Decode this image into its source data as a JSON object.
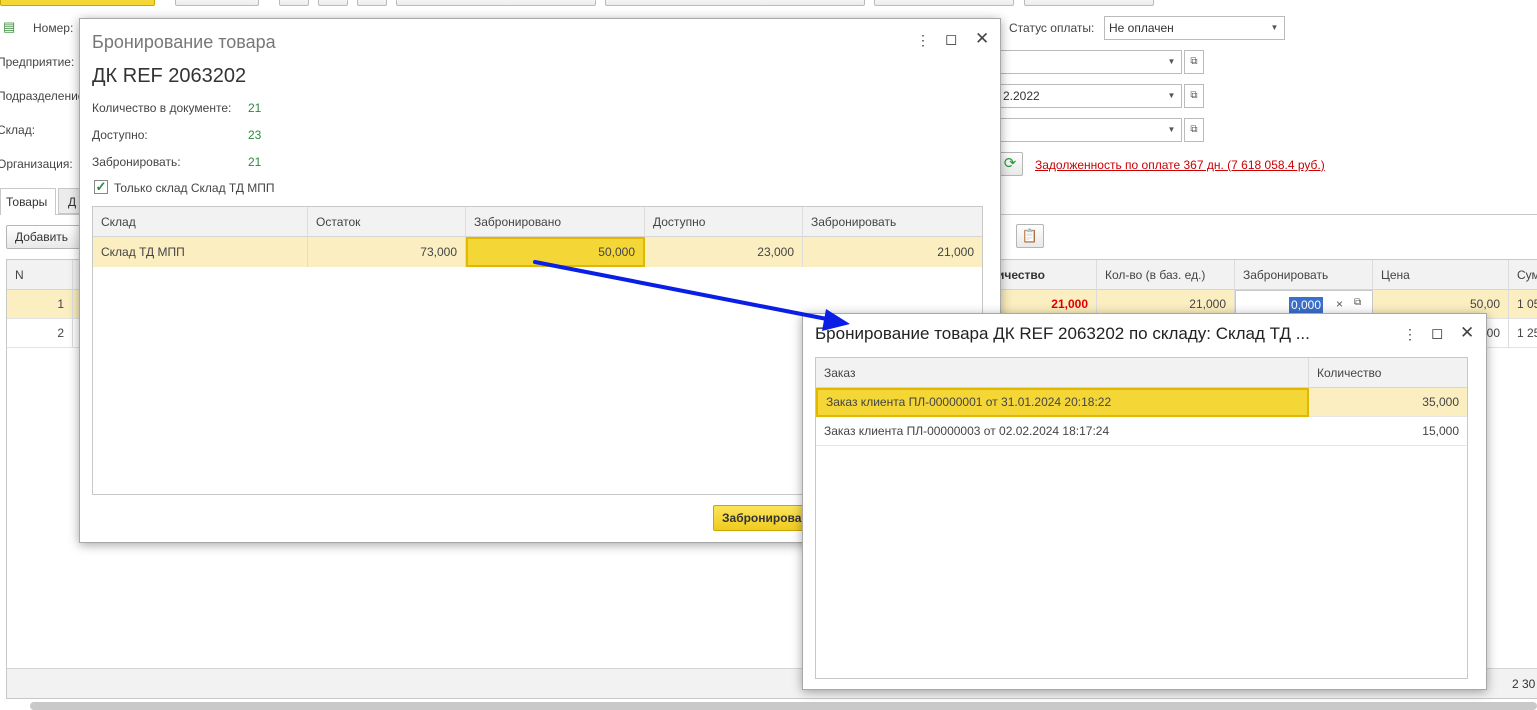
{
  "form": {
    "nomer_label": "Номер:",
    "predpriyatie_label": "Предприятие:",
    "podrazdelenie_label": "Подразделение:",
    "sklad_label": "Склад:",
    "organizaciya_label": "Организация:",
    "status_label": "Статус оплаты:",
    "status_value": "Не оплачен",
    "date_partial": "2.2022",
    "debt_link": "Задолженность по оплате 367 дн. (7 618 058.4 руб.)"
  },
  "tabs": {
    "goods": "Товары",
    "second_partial": "Д"
  },
  "toolbar": {
    "add_label": "Добавить"
  },
  "main_table": {
    "headers": {
      "n": "N",
      "qty_partial": "ичество",
      "qty_base": "Кол-во (в баз. ед.)",
      "reserve": "Забронировать",
      "price": "Цена",
      "sum_partial": "Сум"
    },
    "rows": [
      {
        "n": "1",
        "qty": "21,000",
        "qty_base": "21,000",
        "reserve": "0,000",
        "price": "50,00",
        "sum": "1 05"
      },
      {
        "n": "2",
        "price": "00",
        "sum": "1 25"
      }
    ],
    "footer_sum": "2 30"
  },
  "dialog1": {
    "title": "Бронирование товара",
    "heading": "ДК REF 2063202",
    "qty_doc_label": "Количество в документе:",
    "qty_doc_value": "21",
    "available_label": "Доступно:",
    "available_value": "23",
    "reserve_label": "Забронировать:",
    "reserve_value": "21",
    "checkbox_label": "Только склад Склад ТД МПП",
    "table": {
      "headers": [
        "Склад",
        "Остаток",
        "Забронировано",
        "Доступно",
        "Забронировать"
      ],
      "row": {
        "sklad": "Склад ТД МПП",
        "ostatok": "73,000",
        "zabronirovano": "50,000",
        "dostupno": "23,000",
        "zabronirovat": "21,000"
      }
    },
    "button_label": "Забронировать"
  },
  "dialog2": {
    "title": "Бронирование товара ДК REF 2063202  по складу: Склад ТД ...",
    "table": {
      "headers": [
        "Заказ",
        "Количество"
      ],
      "rows": [
        {
          "order": "Заказ клиента ПЛ-00000001 от 31.01.2024 20:18:22",
          "qty": "35,000"
        },
        {
          "order": "Заказ клиента ПЛ-00000003 от 02.02.2024 18:17:24",
          "qty": "15,000"
        }
      ]
    }
  },
  "colors": {
    "accent_yellow": "#f5d637",
    "row_highlight": "#fbeec0",
    "value_green": "#2b8a3e",
    "debt_red": "#cc0000",
    "arrow_blue": "#0a1fe6"
  }
}
